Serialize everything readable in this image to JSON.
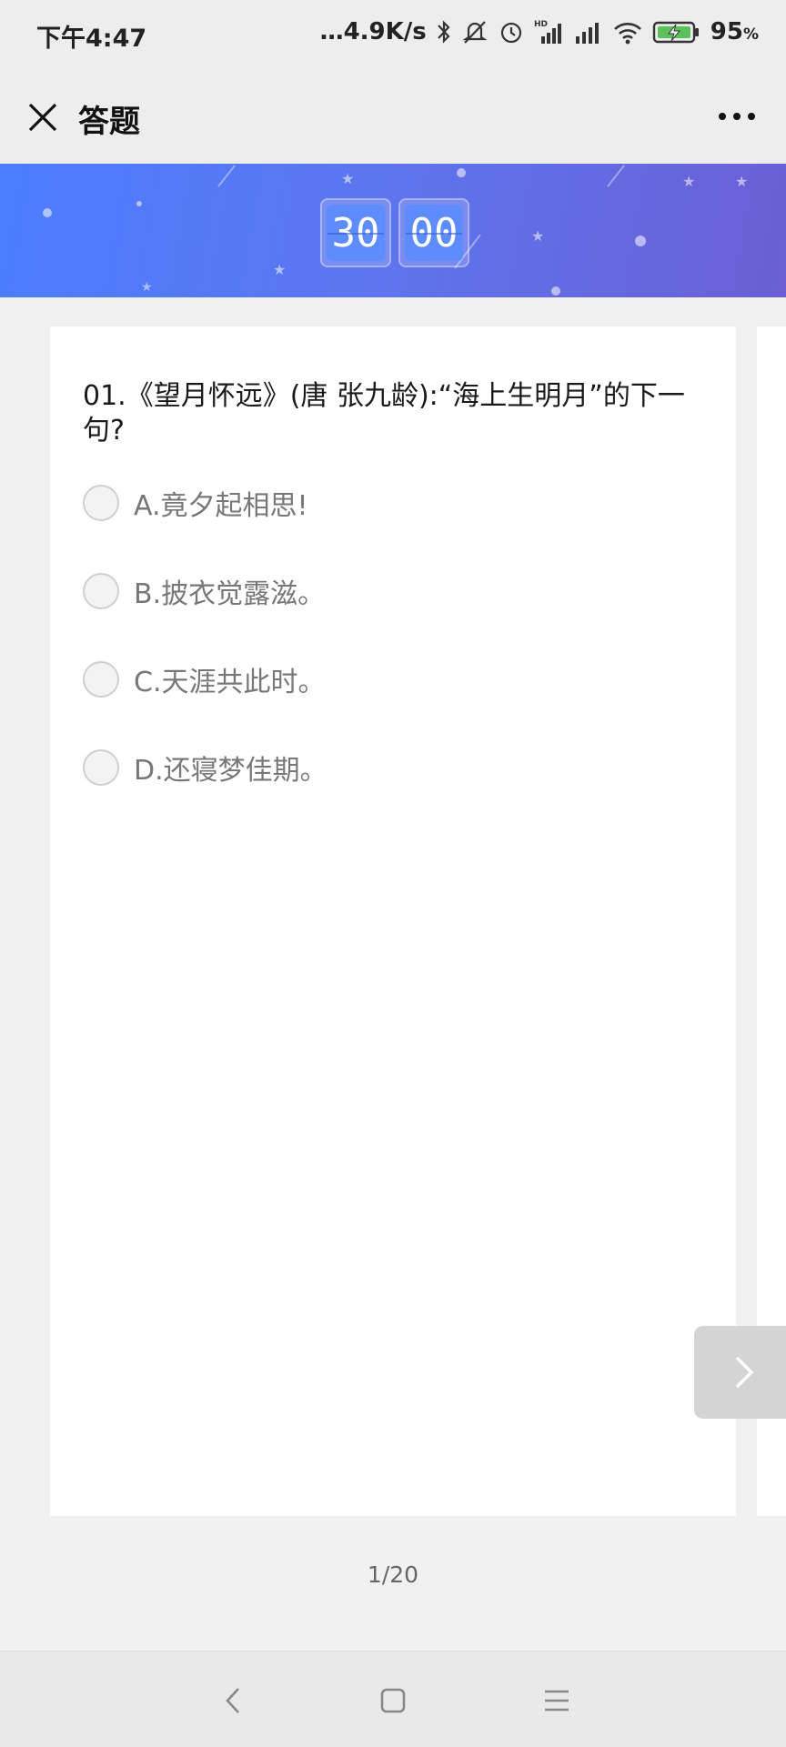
{
  "status_bar": {
    "time": "下午4:47",
    "network_speed": "…4.9K/s",
    "battery_percent": "95",
    "battery_symbol": "%",
    "icons": [
      "bluetooth-icon",
      "mute-icon",
      "alarm-icon",
      "hd-signal-icon",
      "signal-icon",
      "wifi-icon",
      "battery-charging-icon"
    ]
  },
  "navbar": {
    "title": "答题",
    "close_icon": "close-icon",
    "more_icon": "more-dots-icon"
  },
  "timer": {
    "minutes": "30",
    "seconds": "00"
  },
  "question": {
    "text": "01.《望月怀远》(唐 张九龄):“海上生明月”的下一句?",
    "options": [
      {
        "label": "A.竟夕起相思!"
      },
      {
        "label": "B.披衣觉露滋。"
      },
      {
        "label": "C.天涯共此时。"
      },
      {
        "label": "D.还寝梦佳期。"
      }
    ]
  },
  "pager": {
    "text": "1/20"
  },
  "colors": {
    "banner_start": "#4b7dff",
    "banner_end": "#6b5fd4",
    "background": "#f1f1f1"
  }
}
